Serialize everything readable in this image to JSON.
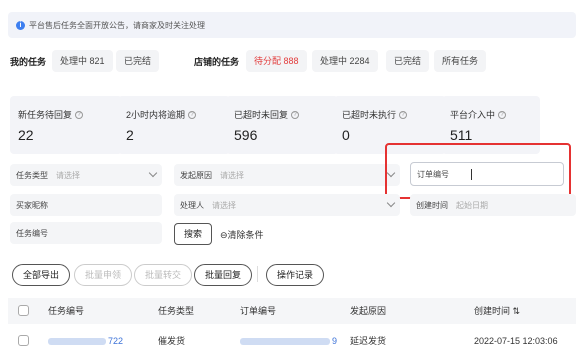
{
  "notice": {
    "text": "平台售后任务全面开放公告，请商家及时关注处理"
  },
  "my_tasks": {
    "label": "我的任务",
    "tabs": [
      "处理中 821",
      "已完结"
    ]
  },
  "shop_tasks": {
    "label": "店铺的任务",
    "tabs": [
      "待分配 888",
      "处理中 2284",
      "已完结",
      "所有任务"
    ],
    "active_color": "#e23b3b"
  },
  "stats": [
    {
      "label": "新任务待回复",
      "value": "22"
    },
    {
      "label": "2小时内将逾期",
      "value": "2"
    },
    {
      "label": "已超时未回复",
      "value": "596"
    },
    {
      "label": "已超时未执行",
      "value": "0"
    },
    {
      "label": "平台介入中",
      "value": "511"
    }
  ],
  "filters": {
    "task_type": {
      "label": "任务类型",
      "placeholder": "请选择"
    },
    "reason": {
      "label": "发起原因",
      "placeholder": "请选择"
    },
    "order_no": {
      "label": "订单编号",
      "value": ""
    },
    "buyer": {
      "label": "买家昵称"
    },
    "handler": {
      "label": "处理人",
      "placeholder": "请选择"
    },
    "created": {
      "label": "创建时间",
      "placeholder": "起始日期"
    },
    "task_no": {
      "label": "任务编号"
    },
    "search_label": "搜索",
    "clear_label": "清除条件"
  },
  "actions": {
    "export_all": "全部导出",
    "batch_claim": "批量申领",
    "batch_transfer": "批量转交",
    "batch_reply": "批量回复",
    "operation_log": "操作记录"
  },
  "table": {
    "columns": [
      "任务编号",
      "任务类型",
      "订单编号",
      "发起原因",
      "创建时间"
    ],
    "rows": [
      {
        "task_no_suffix": "722",
        "task_type": "催发货",
        "order_no_suffix": "9",
        "reason": "延迟发货",
        "created": "2022-07-15 12:03:06"
      }
    ]
  }
}
